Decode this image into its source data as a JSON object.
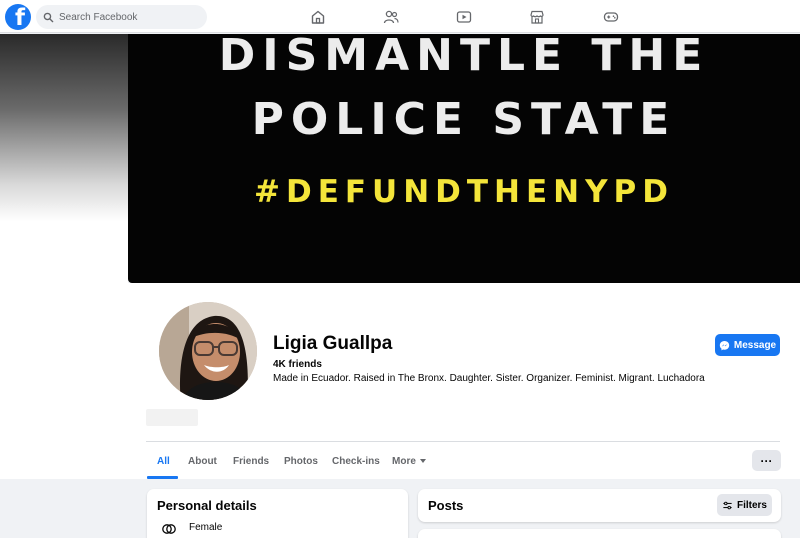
{
  "topbar": {
    "search_placeholder": "Search Facebook",
    "logo_letter": "f",
    "nav_icons": [
      "home-icon",
      "friends-icon",
      "watch-icon",
      "marketplace-icon",
      "gaming-icon"
    ]
  },
  "cover": {
    "line1": "DISMANTLE THE",
    "line2": "POLICE STATE",
    "line3": "#DEFUNDTHENYPD"
  },
  "profile": {
    "name": "Ligia Guallpa",
    "friends": "4K friends",
    "bio": "Made in Ecuador. Raised in The Bronx. Daughter. Sister. Organizer. Feminist. Migrant. Luchadora",
    "message_label": "Message"
  },
  "tabs": [
    "All",
    "About",
    "Friends",
    "Photos",
    "Check-ins",
    "More"
  ],
  "personal": {
    "title": "Personal details",
    "gender": "Female"
  },
  "posts": {
    "title": "Posts",
    "filters_label": "Filters"
  },
  "colors": {
    "accent": "#1877f2",
    "cover_bg": "#040404",
    "cover_yellow": "#f4e53a"
  }
}
